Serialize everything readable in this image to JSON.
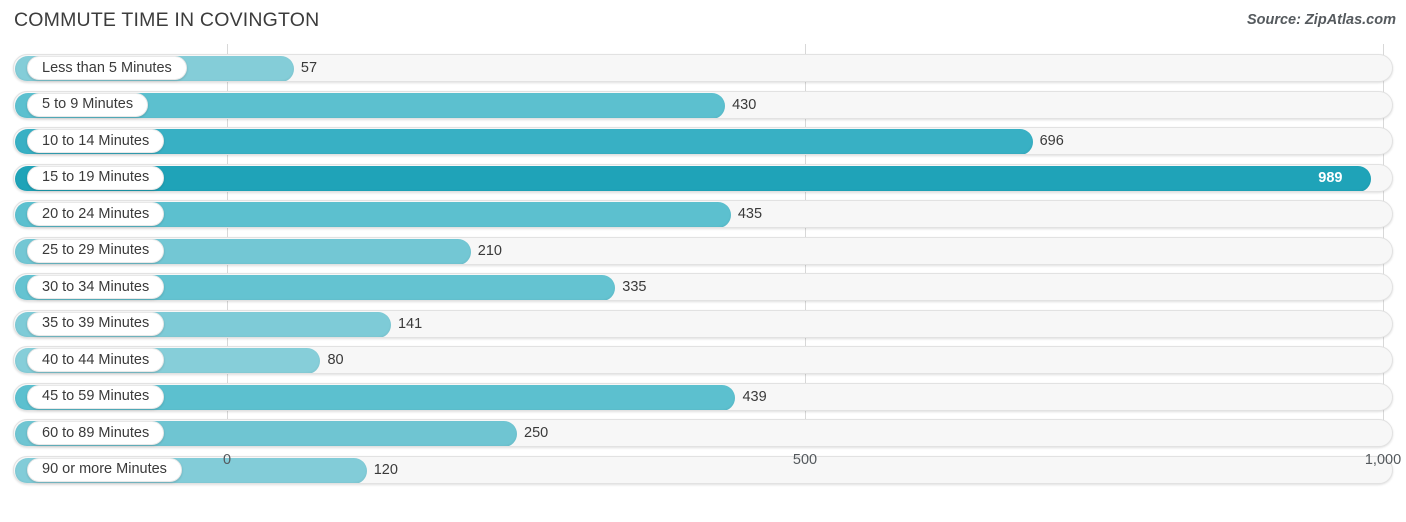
{
  "header": {
    "title": "COMMUTE TIME IN COVINGTON",
    "source": "Source: ZipAtlas.com"
  },
  "chart_data": {
    "type": "bar",
    "orientation": "horizontal",
    "title": "COMMUTE TIME IN COVINGTON",
    "xlabel": "",
    "ylabel": "",
    "xlim": [
      0,
      1000
    ],
    "grid": true,
    "gridlines": [
      0,
      500,
      1000
    ],
    "tick_labels": [
      "0",
      "500",
      "1,000"
    ],
    "legend": "none",
    "categories": [
      "Less than 5 Minutes",
      "5 to 9 Minutes",
      "10 to 14 Minutes",
      "15 to 19 Minutes",
      "20 to 24 Minutes",
      "25 to 29 Minutes",
      "30 to 34 Minutes",
      "35 to 39 Minutes",
      "40 to 44 Minutes",
      "45 to 59 Minutes",
      "60 to 89 Minutes",
      "90 or more Minutes"
    ],
    "values": [
      57,
      430,
      696,
      989,
      435,
      210,
      335,
      141,
      80,
      439,
      250,
      120
    ],
    "value_labels": [
      "57",
      "430",
      "696",
      "989",
      "435",
      "210",
      "335",
      "141",
      "80",
      "439",
      "250",
      "120"
    ],
    "bar_colors": [
      "#84cdd8",
      "#5cc0cf",
      "#38b0c4",
      "#1fa3b8",
      "#5cc0cf",
      "#73c7d4",
      "#64c3d1",
      "#7ecbd7",
      "#86ced9",
      "#5cc0cf",
      "#6fc5d2",
      "#82ccd8"
    ]
  },
  "colors": {
    "accent_dark": "#1fa3b8",
    "accent_light": "#86ced9",
    "track": "#f7f7f7",
    "gridline": "#d8d8d8",
    "text": "#3a3a3a"
  }
}
